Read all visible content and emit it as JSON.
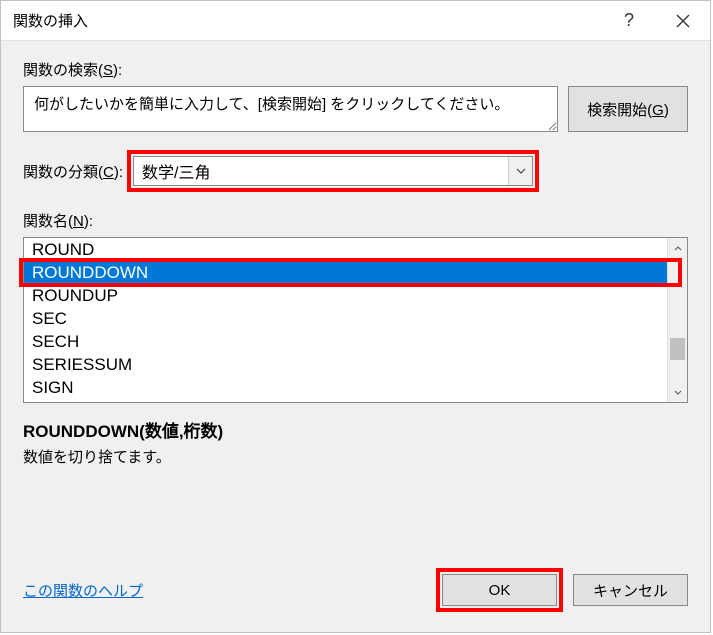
{
  "titlebar": {
    "title": "関数の挿入"
  },
  "search": {
    "label_pre": "関数の検索(",
    "label_u": "S",
    "label_post": "):",
    "value": "何がしたいかを簡単に入力して、[検索開始] をクリックしてください。",
    "btn_pre": "検索開始(",
    "btn_u": "G",
    "btn_post": ")"
  },
  "category": {
    "label_pre": "関数の分類(",
    "label_u": "C",
    "label_post": "):",
    "selected": "数学/三角"
  },
  "funcname": {
    "label_pre": "関数名(",
    "label_u": "N",
    "label_post": "):",
    "items": [
      "ROUND",
      "ROUNDDOWN",
      "ROUNDUP",
      "SEC",
      "SECH",
      "SERIESSUM",
      "SIGN"
    ],
    "selected_index": 1
  },
  "detail": {
    "syntax": "ROUNDDOWN(数値,桁数)",
    "desc": "数値を切り捨てます。"
  },
  "footer": {
    "help": "この関数のヘルプ",
    "ok": "OK",
    "cancel": "キャンセル"
  }
}
